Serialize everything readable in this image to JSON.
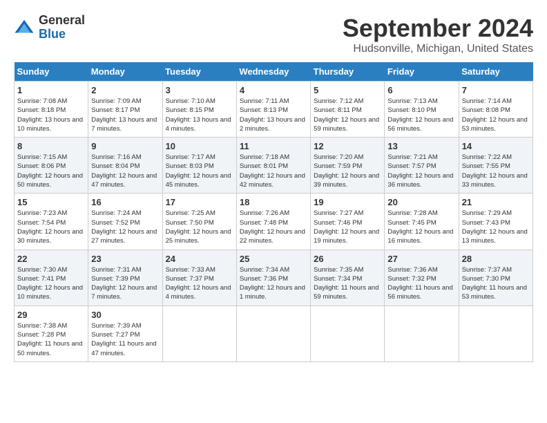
{
  "logo": {
    "line1": "General",
    "line2": "Blue"
  },
  "title": "September 2024",
  "subtitle": "Hudsonville, Michigan, United States",
  "weekdays": [
    "Sunday",
    "Monday",
    "Tuesday",
    "Wednesday",
    "Thursday",
    "Friday",
    "Saturday"
  ],
  "weeks": [
    [
      {
        "day": 1,
        "sunrise": "7:08 AM",
        "sunset": "8:18 PM",
        "daylight": "13 hours and 10 minutes."
      },
      {
        "day": 2,
        "sunrise": "7:09 AM",
        "sunset": "8:17 PM",
        "daylight": "13 hours and 7 minutes."
      },
      {
        "day": 3,
        "sunrise": "7:10 AM",
        "sunset": "8:15 PM",
        "daylight": "13 hours and 4 minutes."
      },
      {
        "day": 4,
        "sunrise": "7:11 AM",
        "sunset": "8:13 PM",
        "daylight": "13 hours and 2 minutes."
      },
      {
        "day": 5,
        "sunrise": "7:12 AM",
        "sunset": "8:11 PM",
        "daylight": "12 hours and 59 minutes."
      },
      {
        "day": 6,
        "sunrise": "7:13 AM",
        "sunset": "8:10 PM",
        "daylight": "12 hours and 56 minutes."
      },
      {
        "day": 7,
        "sunrise": "7:14 AM",
        "sunset": "8:08 PM",
        "daylight": "12 hours and 53 minutes."
      }
    ],
    [
      {
        "day": 8,
        "sunrise": "7:15 AM",
        "sunset": "8:06 PM",
        "daylight": "12 hours and 50 minutes."
      },
      {
        "day": 9,
        "sunrise": "7:16 AM",
        "sunset": "8:04 PM",
        "daylight": "12 hours and 47 minutes."
      },
      {
        "day": 10,
        "sunrise": "7:17 AM",
        "sunset": "8:03 PM",
        "daylight": "12 hours and 45 minutes."
      },
      {
        "day": 11,
        "sunrise": "7:18 AM",
        "sunset": "8:01 PM",
        "daylight": "12 hours and 42 minutes."
      },
      {
        "day": 12,
        "sunrise": "7:20 AM",
        "sunset": "7:59 PM",
        "daylight": "12 hours and 39 minutes."
      },
      {
        "day": 13,
        "sunrise": "7:21 AM",
        "sunset": "7:57 PM",
        "daylight": "12 hours and 36 minutes."
      },
      {
        "day": 14,
        "sunrise": "7:22 AM",
        "sunset": "7:55 PM",
        "daylight": "12 hours and 33 minutes."
      }
    ],
    [
      {
        "day": 15,
        "sunrise": "7:23 AM",
        "sunset": "7:54 PM",
        "daylight": "12 hours and 30 minutes."
      },
      {
        "day": 16,
        "sunrise": "7:24 AM",
        "sunset": "7:52 PM",
        "daylight": "12 hours and 27 minutes."
      },
      {
        "day": 17,
        "sunrise": "7:25 AM",
        "sunset": "7:50 PM",
        "daylight": "12 hours and 25 minutes."
      },
      {
        "day": 18,
        "sunrise": "7:26 AM",
        "sunset": "7:48 PM",
        "daylight": "12 hours and 22 minutes."
      },
      {
        "day": 19,
        "sunrise": "7:27 AM",
        "sunset": "7:46 PM",
        "daylight": "12 hours and 19 minutes."
      },
      {
        "day": 20,
        "sunrise": "7:28 AM",
        "sunset": "7:45 PM",
        "daylight": "12 hours and 16 minutes."
      },
      {
        "day": 21,
        "sunrise": "7:29 AM",
        "sunset": "7:43 PM",
        "daylight": "12 hours and 13 minutes."
      }
    ],
    [
      {
        "day": 22,
        "sunrise": "7:30 AM",
        "sunset": "7:41 PM",
        "daylight": "12 hours and 10 minutes."
      },
      {
        "day": 23,
        "sunrise": "7:31 AM",
        "sunset": "7:39 PM",
        "daylight": "12 hours and 7 minutes."
      },
      {
        "day": 24,
        "sunrise": "7:33 AM",
        "sunset": "7:37 PM",
        "daylight": "12 hours and 4 minutes."
      },
      {
        "day": 25,
        "sunrise": "7:34 AM",
        "sunset": "7:36 PM",
        "daylight": "12 hours and 1 minute."
      },
      {
        "day": 26,
        "sunrise": "7:35 AM",
        "sunset": "7:34 PM",
        "daylight": "11 hours and 59 minutes."
      },
      {
        "day": 27,
        "sunrise": "7:36 AM",
        "sunset": "7:32 PM",
        "daylight": "11 hours and 56 minutes."
      },
      {
        "day": 28,
        "sunrise": "7:37 AM",
        "sunset": "7:30 PM",
        "daylight": "11 hours and 53 minutes."
      }
    ],
    [
      {
        "day": 29,
        "sunrise": "7:38 AM",
        "sunset": "7:28 PM",
        "daylight": "11 hours and 50 minutes."
      },
      {
        "day": 30,
        "sunrise": "7:39 AM",
        "sunset": "7:27 PM",
        "daylight": "11 hours and 47 minutes."
      },
      null,
      null,
      null,
      null,
      null
    ]
  ]
}
